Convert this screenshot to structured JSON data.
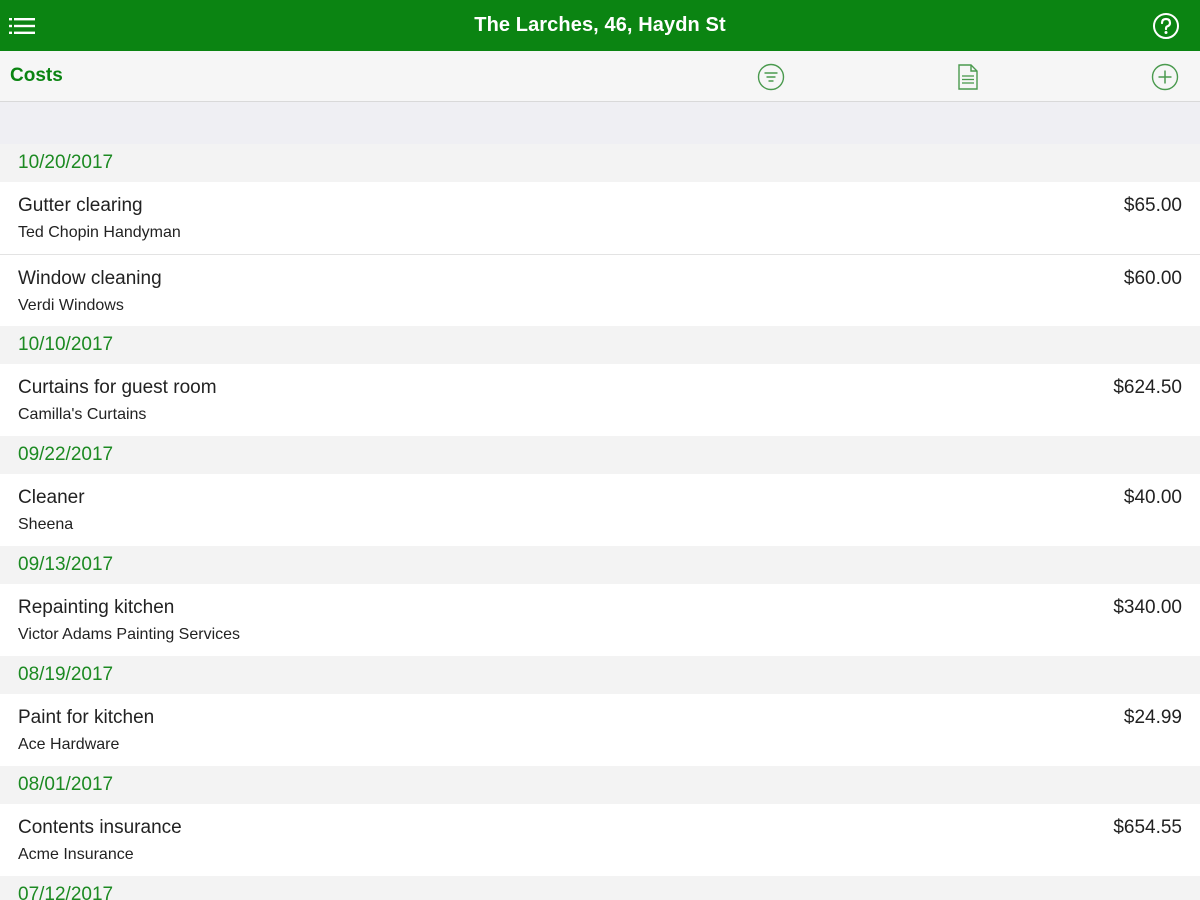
{
  "header": {
    "title": "The Larches, 46, Haydn St",
    "menu_icon": "hamburger-icon",
    "help_icon": "question-circle-icon",
    "bar_color": "#0b8412"
  },
  "toolbar": {
    "section_title": "Costs",
    "filter_icon": "filter-icon",
    "report_icon": "document-icon",
    "add_icon": "plus-circle-icon",
    "accent_color": "#0b8412"
  },
  "groups": [
    {
      "date": "10/20/2017",
      "items": [
        {
          "title": "Gutter clearing",
          "vendor": "Ted Chopin Handyman",
          "amount": "$65.00"
        },
        {
          "title": "Window cleaning",
          "vendor": "Verdi Windows",
          "amount": "$60.00"
        }
      ]
    },
    {
      "date": "10/10/2017",
      "items": [
        {
          "title": "Curtains for guest room",
          "vendor": "Camilla's Curtains",
          "amount": "$624.50"
        }
      ]
    },
    {
      "date": "09/22/2017",
      "items": [
        {
          "title": "Cleaner",
          "vendor": "Sheena",
          "amount": "$40.00"
        }
      ]
    },
    {
      "date": "09/13/2017",
      "items": [
        {
          "title": "Repainting kitchen",
          "vendor": "Victor Adams Painting Services",
          "amount": "$340.00"
        }
      ]
    },
    {
      "date": "08/19/2017",
      "items": [
        {
          "title": "Paint for kitchen",
          "vendor": "Ace Hardware",
          "amount": "$24.99"
        }
      ]
    },
    {
      "date": "08/01/2017",
      "items": [
        {
          "title": "Contents insurance",
          "vendor": "Acme Insurance",
          "amount": "$654.55"
        }
      ]
    },
    {
      "date": "07/12/2017",
      "items": []
    }
  ]
}
